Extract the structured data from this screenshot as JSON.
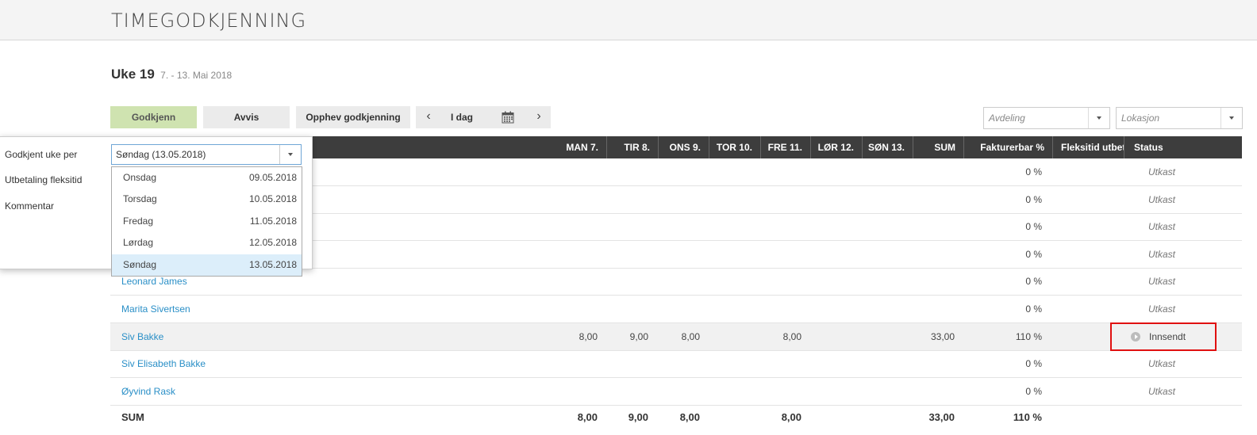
{
  "app": {
    "title": "TIMEGODKJENNING"
  },
  "week": {
    "label": "Uke 19",
    "range": "7. - 13. Mai 2018"
  },
  "toolbar": {
    "approve": "Godkjenn",
    "reject": "Avvis",
    "unapprove": "Opphev godkjenning",
    "prev": "‹",
    "today": "I dag",
    "next": "›"
  },
  "filters": {
    "department": "Avdeling",
    "location": "Lokasjon"
  },
  "columns": [
    "MAN 7.",
    "TIR 8.",
    "ONS 9.",
    "TOR 10.",
    "FRE 11.",
    "LØR 12.",
    "SØN 13.",
    "SUM",
    "Fakturerbar %",
    "Fleksitid utbetalt",
    "Status"
  ],
  "rows": [
    {
      "name": "",
      "mon": "",
      "tue": "",
      "wed": "",
      "thu": "",
      "fri": "",
      "sat": "",
      "sun": "",
      "sum": "",
      "pct": "0 %",
      "status": "Utkast"
    },
    {
      "name": "",
      "mon": "",
      "tue": "",
      "wed": "",
      "thu": "",
      "fri": "",
      "sat": "",
      "sun": "",
      "sum": "",
      "pct": "0 %",
      "status": "Utkast"
    },
    {
      "name": "",
      "mon": "",
      "tue": "",
      "wed": "",
      "thu": "",
      "fri": "",
      "sat": "",
      "sun": "",
      "sum": "",
      "pct": "0 %",
      "status": "Utkast"
    },
    {
      "name": "",
      "mon": "",
      "tue": "",
      "wed": "",
      "thu": "",
      "fri": "",
      "sat": "",
      "sun": "",
      "sum": "",
      "pct": "0 %",
      "status": "Utkast"
    },
    {
      "name": "Leonard James",
      "mon": "",
      "tue": "",
      "wed": "",
      "thu": "",
      "fri": "",
      "sat": "",
      "sun": "",
      "sum": "",
      "pct": "0 %",
      "status": "Utkast"
    },
    {
      "name": "Marita Sivertsen",
      "mon": "",
      "tue": "",
      "wed": "",
      "thu": "",
      "fri": "",
      "sat": "",
      "sun": "",
      "sum": "",
      "pct": "0 %",
      "status": "Utkast"
    },
    {
      "name": "Siv Bakke",
      "mon": "8,00",
      "tue": "9,00",
      "wed": "8,00",
      "thu": "",
      "fri": "8,00",
      "sat": "",
      "sun": "",
      "sum": "33,00",
      "pct": "110 %",
      "status": "Innsendt"
    },
    {
      "name": "Siv Elisabeth Bakke",
      "mon": "",
      "tue": "",
      "wed": "",
      "thu": "",
      "fri": "",
      "sat": "",
      "sun": "",
      "sum": "",
      "pct": "0 %",
      "status": "Utkast"
    },
    {
      "name": "Øyvind Rask",
      "mon": "",
      "tue": "",
      "wed": "",
      "thu": "",
      "fri": "",
      "sat": "",
      "sun": "",
      "sum": "",
      "pct": "0 %",
      "status": "Utkast"
    }
  ],
  "sum": {
    "label": "SUM",
    "mon": "8,00",
    "tue": "9,00",
    "wed": "8,00",
    "fri": "8,00",
    "sum": "33,00",
    "pct": "110 %"
  },
  "popover": {
    "approved_week_label": "Godkjent uke per",
    "payout_label": "Utbetaling fleksitid",
    "comment_label": "Kommentar",
    "selected": "Søndag (13.05.2018)",
    "options": [
      {
        "day": "Onsdag",
        "date": "09.05.2018"
      },
      {
        "day": "Torsdag",
        "date": "10.05.2018"
      },
      {
        "day": "Fredag",
        "date": "11.05.2018"
      },
      {
        "day": "Lørdag",
        "date": "12.05.2018"
      },
      {
        "day": "Søndag",
        "date": "13.05.2018"
      }
    ]
  }
}
